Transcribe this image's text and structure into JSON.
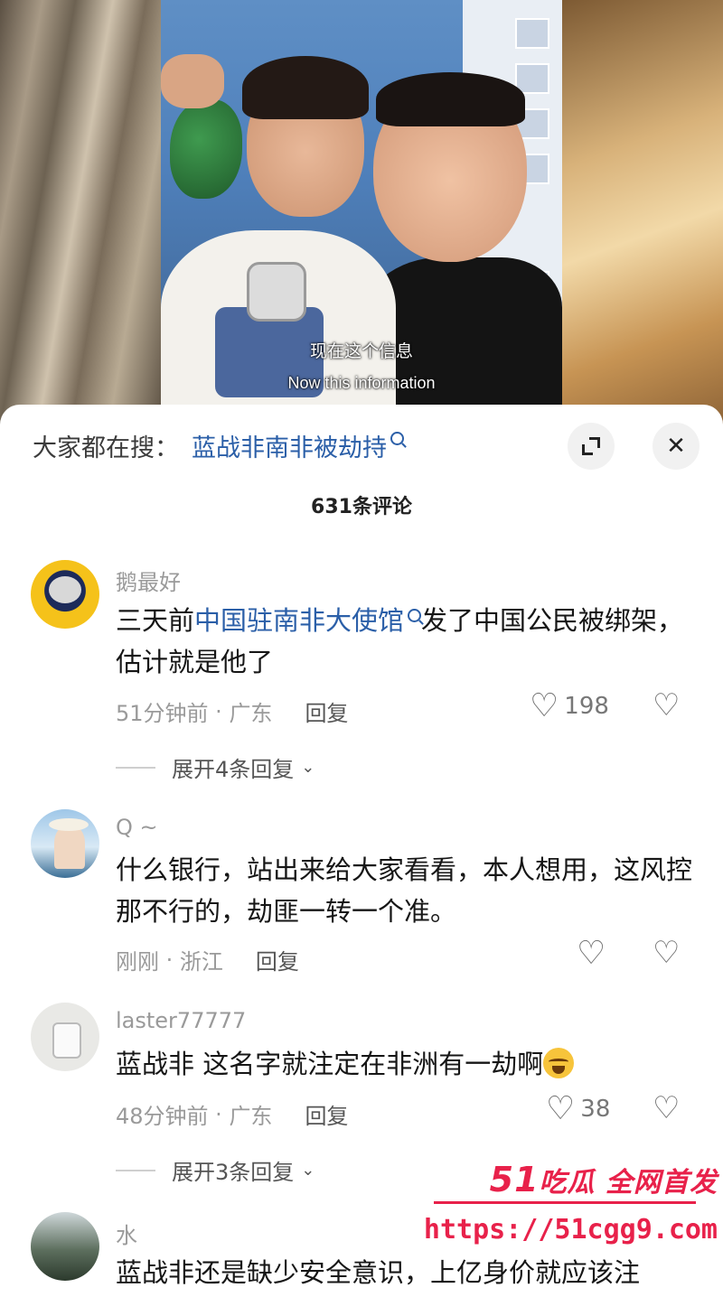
{
  "video": {
    "subtitle_cn": "现在这个信息",
    "subtitle_en": "Now this information"
  },
  "search": {
    "prefix": "大家都在搜：",
    "query": "蓝战非南非被劫持"
  },
  "comment_count": "631条评论",
  "comments": [
    {
      "user": "鹅最好",
      "text_before": "三天前",
      "text_link": "中国驻南非大使馆",
      "text_after": "发了中国公民被绑架，估计就是他了",
      "time": "51分钟前",
      "location": "广东",
      "reply": "回复",
      "likes": "198",
      "expand": "展开4条回复"
    },
    {
      "user": "Q ~",
      "text": "什么银行，站出来给大家看看，本人想用，这风控那不行的，劫匪一转一个准。",
      "time": "刚刚",
      "location": "浙江",
      "reply": "回复",
      "likes": ""
    },
    {
      "user": "laster77777",
      "text": "蓝战非 这名字就注定在非洲有一劫啊",
      "time": "48分钟前",
      "location": "广东",
      "reply": "回复",
      "likes": "38",
      "expand": "展开3条回复"
    },
    {
      "user": "水",
      "text": "蓝战非还是缺少安全意识，上亿身价就应该注"
    }
  ],
  "watermark": {
    "brand_num": "51",
    "brand_text": "吃瓜 全网首发",
    "url": "https://51cgg9.com"
  },
  "icons": {
    "like": "heart-outline",
    "dislike": "broken-heart",
    "close": "close-x",
    "expand": "expand-arrows"
  },
  "colors": {
    "link": "#2b5fa8",
    "watermark": "#e8214a"
  }
}
